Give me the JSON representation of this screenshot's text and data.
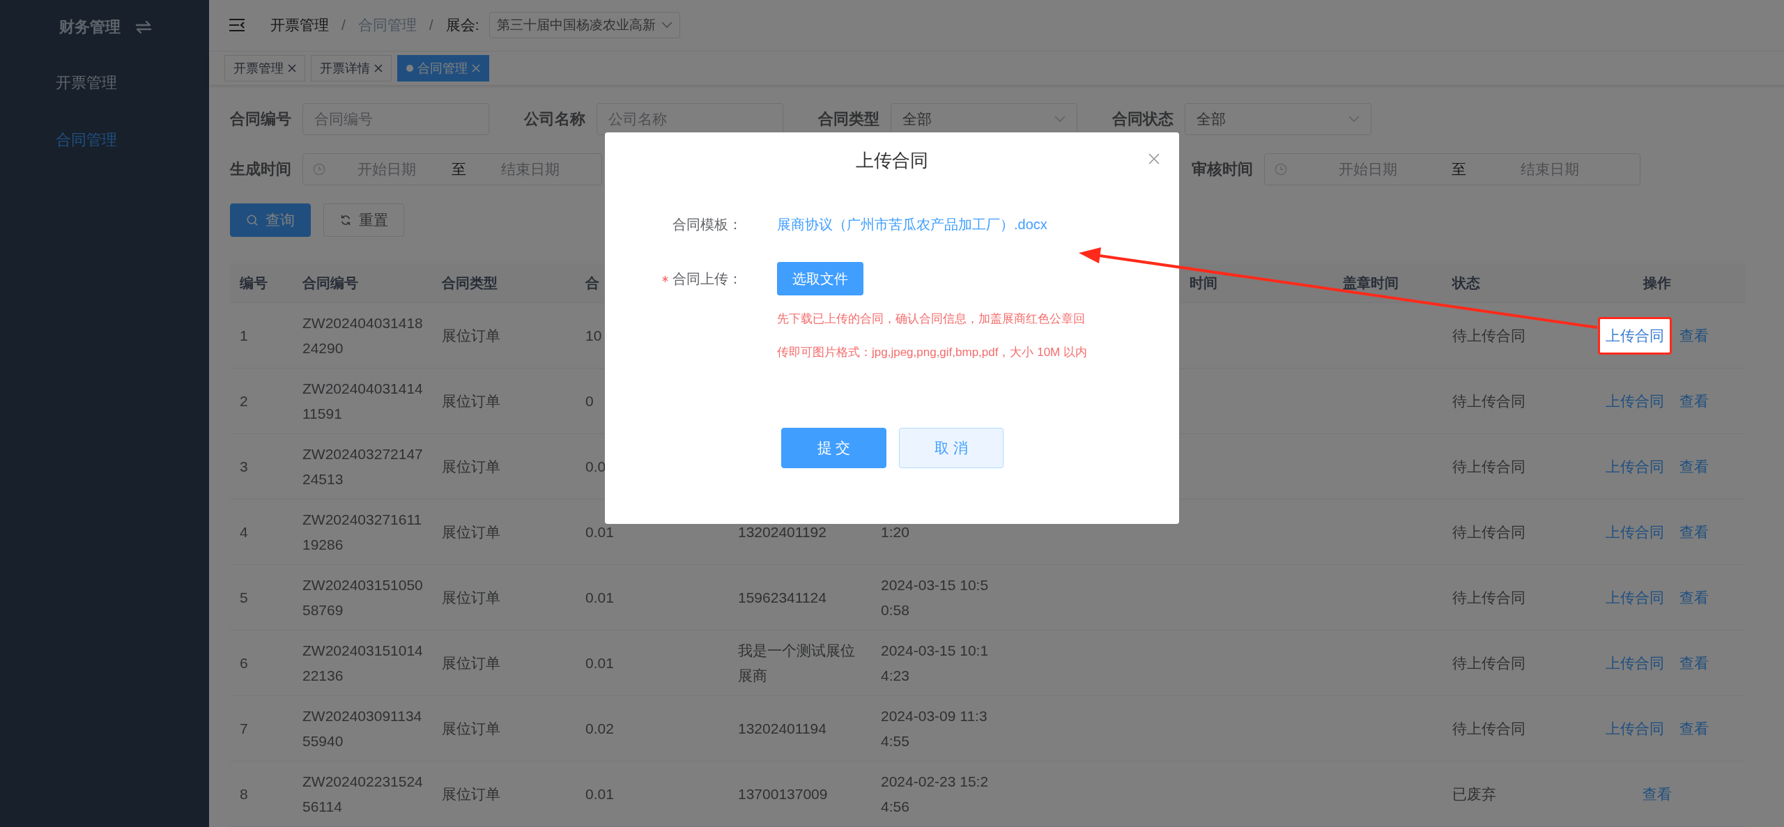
{
  "sidebar": {
    "title": "财务管理",
    "items": [
      {
        "label": "开票管理",
        "selected": false
      },
      {
        "label": "合同管理",
        "selected": true
      }
    ]
  },
  "topbar": {
    "breadcrumb": [
      {
        "label": "开票管理",
        "link": true
      },
      {
        "label": "合同管理",
        "link": false
      }
    ],
    "separator": "/",
    "exhibition": {
      "label": "展会:",
      "value": "第三十届中国杨凌农业高新"
    }
  },
  "tabs": [
    {
      "label": "开票管理",
      "selected": false
    },
    {
      "label": "开票详情",
      "selected": false
    },
    {
      "label": "合同管理",
      "selected": true
    }
  ],
  "filters": [
    {
      "label": "合同编号",
      "kind": "input",
      "placeholder": "合同编号"
    },
    {
      "label": "公司名称",
      "kind": "input",
      "placeholder": "公司名称"
    },
    {
      "label": "合同类型",
      "kind": "select",
      "value": "全部"
    },
    {
      "label": "合同状态",
      "kind": "select",
      "value": "全部"
    },
    {
      "label": "生成时间",
      "kind": "daterange",
      "start_placeholder": "开始日期",
      "separator": "至",
      "end_placeholder": "结束日期"
    },
    {
      "label": "审核时间",
      "kind": "daterange",
      "start_placeholder": "开始日期",
      "separator": "至",
      "end_placeholder": "结束日期"
    }
  ],
  "buttons": [
    {
      "label": "查询",
      "kind": "primary"
    },
    {
      "label": "重置",
      "kind": "default"
    }
  ],
  "table": {
    "headers": {
      "no": "编号",
      "contract_no": "合同编号",
      "contract_type": "合同类型",
      "column_4": "合",
      "column_8": "时间",
      "stamp_time": "盖章时间",
      "status": "状态",
      "actions": "操作"
    },
    "rows": [
      {
        "no": "1",
        "contract_no": "ZW20240403141824290",
        "contract_type": "展位订单",
        "column_4": "10",
        "status": "待上传合同",
        "actions": [
          {
            "label": "上传合同",
            "highlighted": true
          },
          {
            "label": "查看",
            "highlighted": false
          }
        ]
      },
      {
        "no": "2",
        "contract_no": "ZW20240403141411591",
        "contract_type": "展位订单",
        "column_4": "0",
        "status": "待上传合同",
        "actions": [
          {
            "label": "上传合同",
            "highlighted": false
          },
          {
            "label": "查看",
            "highlighted": false
          }
        ]
      },
      {
        "no": "3",
        "contract_no": "ZW20240327214724513",
        "contract_type": "展位订单",
        "column_4": "0.0",
        "status": "待上传合同",
        "actions": [
          {
            "label": "上传合同",
            "highlighted": false
          },
          {
            "label": "查看",
            "highlighted": false
          }
        ]
      },
      {
        "no": "4",
        "contract_no": "ZW20240327161119286",
        "contract_type": "展位订单",
        "column_4": "0.01",
        "column_5": "13202401192",
        "column_6": "1:20",
        "status": "待上传合同",
        "actions": [
          {
            "label": "上传合同",
            "highlighted": false
          },
          {
            "label": "查看",
            "highlighted": false
          }
        ]
      },
      {
        "no": "5",
        "contract_no": "ZW20240315105058769",
        "contract_type": "展位订单",
        "column_4": "0.01",
        "column_5": "15962341124",
        "column_6": "2024-03-15 10:50:58",
        "status": "待上传合同",
        "actions": [
          {
            "label": "上传合同",
            "highlighted": false
          },
          {
            "label": "查看",
            "highlighted": false
          }
        ]
      },
      {
        "no": "6",
        "contract_no": "ZW20240315101422136",
        "contract_type": "展位订单",
        "column_4": "0.01",
        "column_5": "我是一个测试展位展商",
        "column_6": "2024-03-15 10:14:23",
        "status": "待上传合同",
        "actions": [
          {
            "label": "上传合同",
            "highlighted": false
          },
          {
            "label": "查看",
            "highlighted": false
          }
        ]
      },
      {
        "no": "7",
        "contract_no": "ZW20240309113455940",
        "contract_type": "展位订单",
        "column_4": "0.02",
        "column_5": "13202401194",
        "column_6": "2024-03-09 11:34:55",
        "status": "待上传合同",
        "actions": [
          {
            "label": "上传合同",
            "highlighted": false
          },
          {
            "label": "查看",
            "highlighted": false
          }
        ]
      },
      {
        "no": "8",
        "contract_no": "ZW20240223152456114",
        "contract_type": "展位订单",
        "column_4": "0.01",
        "column_5": "13700137009",
        "column_6": "2024-02-23 15:24:56",
        "status": "已废弃",
        "actions": [
          {
            "label": "查看",
            "highlighted": false
          }
        ]
      }
    ]
  },
  "modal": {
    "title": "上传合同",
    "fields": [
      {
        "label": "合同模板：",
        "required": false,
        "kind": "link",
        "value": "展商协议（广州市苦瓜农产品加工厂）.docx"
      },
      {
        "label": "合同上传：",
        "required": true,
        "kind": "upload",
        "button": "选取文件",
        "hints": [
          "先下载已上传的合同，确认合同信息，加盖展商红色公章回",
          "传即可图片格式：jpg,jpeg,png,gif,bmp,pdf，大小 10M 以内"
        ]
      }
    ],
    "buttons": [
      {
        "label": "提 交",
        "kind": "primary"
      },
      {
        "label": "取 消",
        "kind": "plain"
      }
    ]
  }
}
